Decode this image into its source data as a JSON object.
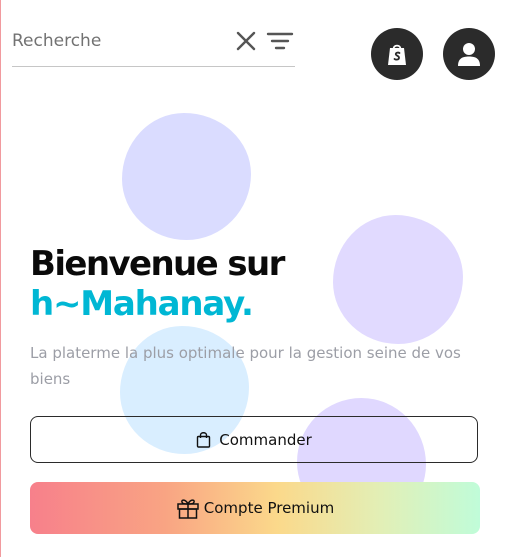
{
  "search": {
    "placeholder": "Recherche",
    "value": "",
    "clear_icon": "close-icon",
    "filter_icon": "filter-icon"
  },
  "header": {
    "shop_icon": "shopify-bag-icon",
    "account_icon": "user-icon"
  },
  "hero": {
    "title": "Bienvenue sur",
    "brand": "h~Mahanay.",
    "subtitle": "La platerme la plus optimale pour la gestion seine de vos biens"
  },
  "actions": {
    "order_label": "Commander",
    "order_icon": "shopping-bag-icon",
    "premium_label": "Compte Premium",
    "premium_icon": "gift-icon"
  },
  "colors": {
    "brand": "#00b7d4",
    "dark": "#2b2b2b",
    "blob": "#dadcff",
    "premium_gradient": [
      "#f7808b",
      "#fbd98b",
      "#c0fcd9"
    ]
  }
}
